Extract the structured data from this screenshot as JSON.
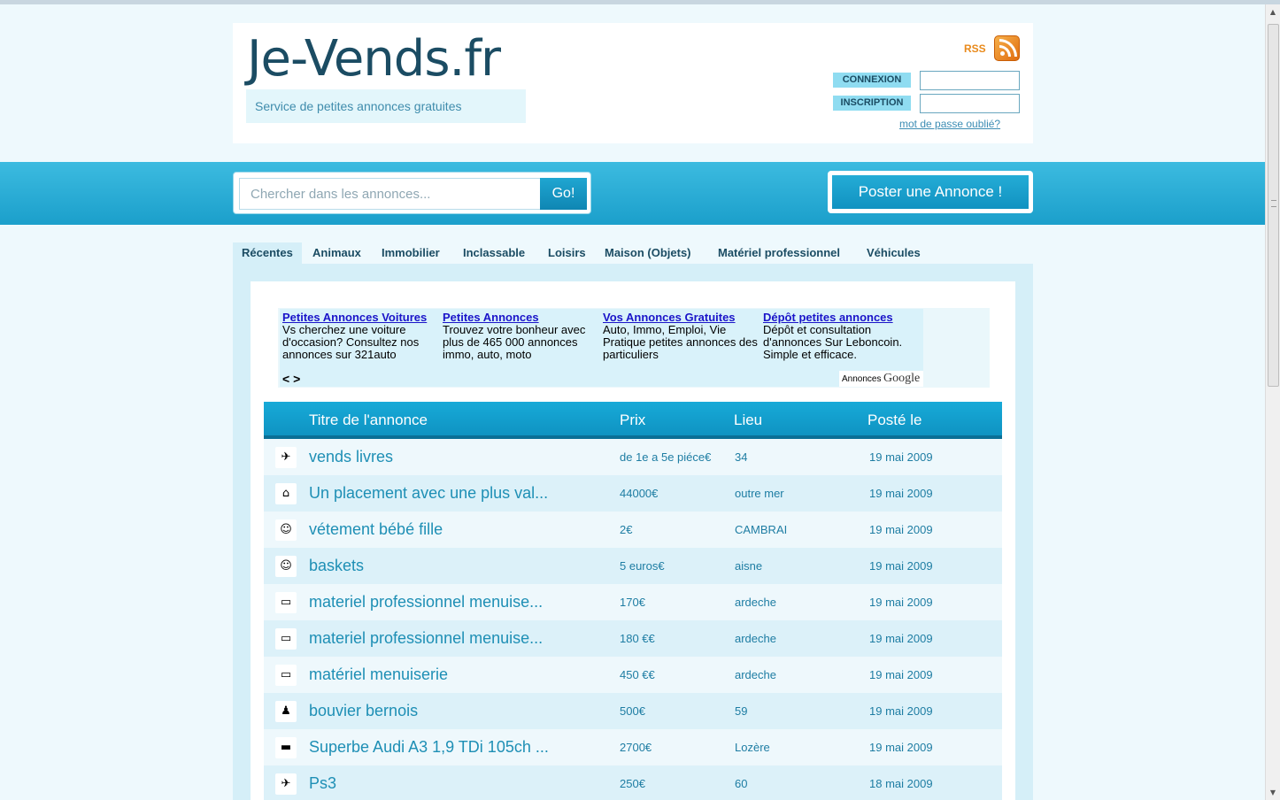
{
  "header": {
    "logo": "Je-Vends.fr",
    "tagline": "Service de petites annonces gratuites",
    "rss_label": "RSS",
    "login_label": "CONNEXION",
    "signup_label": "INSCRIPTION",
    "forgot_password": "mot de passe oublié?"
  },
  "search": {
    "placeholder": "Chercher dans les annonces...",
    "button": "Go!"
  },
  "post_button": "Poster une Annonce !",
  "tabs": [
    "Récentes",
    "Animaux",
    "Immobilier",
    "Inclassable",
    "Loisirs",
    "Maison (Objets)",
    "Matériel professionnel",
    "Véhicules"
  ],
  "ads": {
    "items": [
      {
        "title": "Petites Annonces Voitures",
        "text": "Vs cherchez une voiture d'occasion? Consultez nos annonces sur 321auto"
      },
      {
        "title": "Petites Annonces",
        "text": "Trouvez votre bonheur avec plus de 465 000 annonces immo, auto, moto"
      },
      {
        "title": "Vos Annonces Gratuites",
        "text": "Auto, Immo, Emploi, Vie Pratique petites annonces des particuliers"
      },
      {
        "title": "Dépôt petites annonces",
        "text": "Dépôt et consultation d'annonces Sur Leboncoin. Simple et efficace."
      }
    ],
    "nav": "< >",
    "sponsor_small": "Annonces",
    "sponsor_brand": "Google"
  },
  "table": {
    "headers": {
      "title": "Titre de l'annonce",
      "price": "Prix",
      "place": "Lieu",
      "date": "Posté le"
    },
    "rows": [
      {
        "icon": "loisirs-icon",
        "glyph": "✈",
        "title": "vends livres",
        "price": "de 1e a 5e piéce€",
        "place": "34",
        "date": "19 mai 2009"
      },
      {
        "icon": "house-icon",
        "glyph": "⌂",
        "title": "Un placement avec une plus val...",
        "price": "44000€",
        "place": "outre mer",
        "date": "19 mai 2009"
      },
      {
        "icon": "person-icon",
        "glyph": "☺",
        "title": "vétement bébé fille",
        "price": "2€",
        "place": "CAMBRAI",
        "date": "19 mai 2009"
      },
      {
        "icon": "person-icon",
        "glyph": "☺",
        "title": "baskets",
        "price": "5 euros€",
        "place": "aisne",
        "date": "19 mai 2009"
      },
      {
        "icon": "folder-icon",
        "glyph": "▭",
        "title": "materiel professionnel menuise...",
        "price": "170€",
        "place": "ardeche",
        "date": "19 mai 2009"
      },
      {
        "icon": "folder-icon",
        "glyph": "▭",
        "title": "materiel professionnel menuise...",
        "price": "180 €€",
        "place": "ardeche",
        "date": "19 mai 2009"
      },
      {
        "icon": "folder-icon",
        "glyph": "▭",
        "title": "matériel menuiserie",
        "price": "450 €€",
        "place": "ardeche",
        "date": "19 mai 2009"
      },
      {
        "icon": "penguin-icon",
        "glyph": "♟",
        "title": "bouvier bernois",
        "price": "500€",
        "place": "59",
        "date": "19 mai 2009"
      },
      {
        "icon": "car-icon",
        "glyph": "▬",
        "title": "Superbe Audi A3 1,9 TDi 105ch ...",
        "price": "2700€",
        "place": "Lozère",
        "date": "19 mai 2009"
      },
      {
        "icon": "loisirs-icon",
        "glyph": "✈",
        "title": "Ps3",
        "price": "250€",
        "place": "60",
        "date": "18 mai 2009"
      }
    ]
  },
  "colors": {
    "brand_dark": "#1b4c63",
    "accent_blue": "#1fa6d1",
    "rss_orange": "#e98a1b",
    "link_blue": "#1a14c9"
  }
}
